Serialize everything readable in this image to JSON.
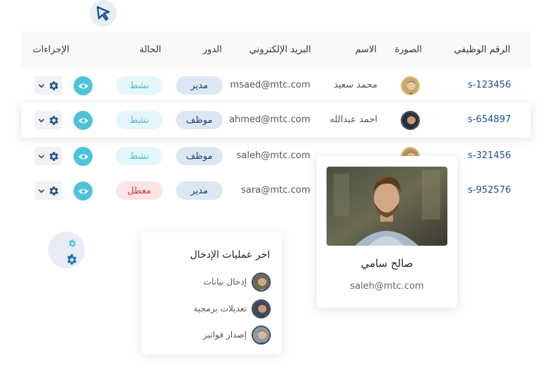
{
  "table": {
    "headers": {
      "emp_id": "الرقم الوظيفي",
      "photo": "الصورة",
      "name": "الاسم",
      "email": "البريد الإلكتروني",
      "role": "الدور",
      "status": "الحالة",
      "actions": "الإجراءات"
    },
    "rows": [
      {
        "emp_id": "s-123456",
        "name": "محمد سعيد",
        "email": "msaed@mtc.com",
        "role": "مدير",
        "status": "نشط"
      },
      {
        "emp_id": "s-654897",
        "name": "احمد عبدالله",
        "email": "ahmed@mtc.com",
        "role": "موظف",
        "status": "نشط"
      },
      {
        "emp_id": "s-321456",
        "name": "",
        "email": "saleh@mtc.com",
        "role": "موظف",
        "status": "نشط"
      },
      {
        "emp_id": "s-952576",
        "name": "",
        "email": "sara@mtc.com",
        "role": "مدير",
        "status": "معطل"
      }
    ]
  },
  "profile": {
    "name": "صالح سامي",
    "email": "saleh@mtc.com"
  },
  "log": {
    "title": "اخر عمليات الإدخال",
    "items": [
      {
        "label": "إدخال بيانات"
      },
      {
        "label": "تعديلات برمجية"
      },
      {
        "label": "إصدار فواتير"
      }
    ]
  },
  "icons": {
    "cursor": "cursor-arrow-icon",
    "eye": "eye-icon",
    "gear": "gear-icon",
    "chevron": "chevron-down-icon",
    "gears": "gears-icon"
  },
  "colors": {
    "accent": "#4ec3d8",
    "primary": "#1d4e8f",
    "gear": "#1d4e8f",
    "inactive": "#d93343"
  }
}
